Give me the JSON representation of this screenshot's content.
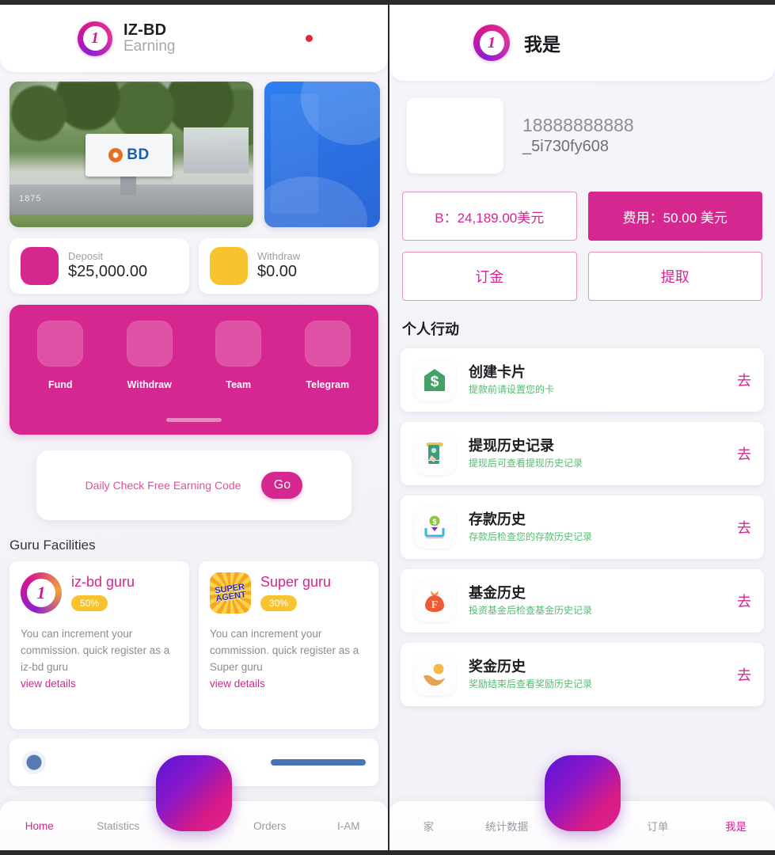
{
  "left": {
    "header": {
      "logo_number": "1",
      "title": "IZ-BD",
      "subtitle": "Earning",
      "notification": "unread-dot"
    },
    "banners": {
      "main_alt": "BD company campus sign",
      "main_sign_text": "BD",
      "main_address_number": "1875",
      "side_alt": "blue gradient promo card"
    },
    "stats": [
      {
        "label": "Deposit",
        "value": "$25,000.00",
        "color": "#d6278f"
      },
      {
        "label": "Withdraw",
        "value": "$0.00",
        "color": "#f7c32e"
      }
    ],
    "quick_actions": [
      {
        "label": "Fund",
        "icon": "fund-icon"
      },
      {
        "label": "Withdraw",
        "icon": "withdraw-icon"
      },
      {
        "label": "Team",
        "icon": "team-icon"
      },
      {
        "label": "Telegram",
        "icon": "telegram-icon"
      }
    ],
    "check_card": {
      "text": "Daily Check Free Earning Code",
      "button": "Go"
    },
    "guru_section_title": "Guru Facilities",
    "gurus": [
      {
        "name": "iz-bd guru",
        "percent": "50%",
        "icon": "iz-bd-ring-icon",
        "badge_number": "1",
        "description": "You can increment your commission. quick register as a iz-bd guru",
        "link": "view details"
      },
      {
        "name": "Super guru",
        "percent": "30%",
        "icon": "super-agent-icon",
        "badge_text": "SUPER AGENT",
        "description": "You can increment your commission. quick register as a Super guru",
        "link": "view details"
      }
    ],
    "nav": [
      {
        "label": "Home",
        "active": true
      },
      {
        "label": "Statistics",
        "active": false
      },
      {
        "label": "Orders",
        "active": false
      },
      {
        "label": "I-AM",
        "active": false
      }
    ],
    "fab": "center-action-button"
  },
  "right": {
    "header": {
      "logo_number": "1",
      "title": "我是"
    },
    "profile": {
      "phone": "18888888888",
      "user_id": "_5i730fy608",
      "avatar": "user-avatar-placeholder"
    },
    "balance": [
      {
        "label": "B：24,189.00美元",
        "style": "outline"
      },
      {
        "label": "费用：50.00 美元",
        "style": "filled"
      },
      {
        "label": "订金",
        "style": "outline"
      },
      {
        "label": "提取",
        "style": "outline"
      }
    ],
    "section_title": "个人行动",
    "actions": [
      {
        "title": "创建卡片",
        "subtitle": "提款前请设置您的卡",
        "go": "去",
        "icon": "green-card-dollar-icon"
      },
      {
        "title": "提现历史记录",
        "subtitle": "提现后可查看提现历史记录",
        "go": "去",
        "icon": "atm-withdraw-icon"
      },
      {
        "title": "存款历史",
        "subtitle": "存款后检查您的存款历史记录",
        "go": "去",
        "icon": "deposit-coin-icon"
      },
      {
        "title": "基金历史",
        "subtitle": "投资基金后检查基金历史记录",
        "go": "去",
        "icon": "money-bag-icon"
      },
      {
        "title": "奖金历史",
        "subtitle": "奖励结束后查看奖励历史记录",
        "go": "去",
        "icon": "hand-coin-icon"
      }
    ],
    "nav": [
      {
        "label": "家",
        "active": false
      },
      {
        "label": "统计数据",
        "active": false
      },
      {
        "label": "订单",
        "active": false
      },
      {
        "label": "我是",
        "active": true
      }
    ],
    "fab": "center-action-button"
  },
  "colors": {
    "accent_pink": "#d6268f",
    "accent_amber": "#f7c32e",
    "accent_green": "#4fbf6e",
    "notif_red": "#e0263d"
  }
}
